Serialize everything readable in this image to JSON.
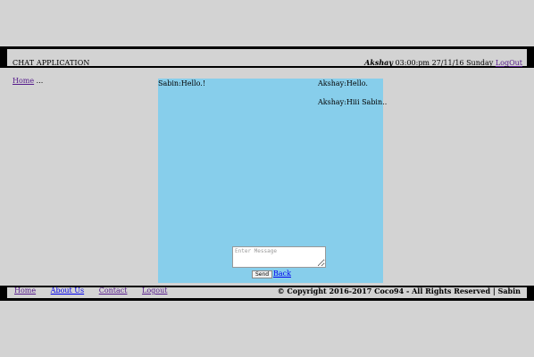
{
  "header": {
    "title": "CHAT APPLICATION",
    "user": "Akshay",
    "time": "03:00:pm",
    "date": "27/11/16",
    "day": "Sunday",
    "logout_label": "LogOut"
  },
  "breadcrumb": {
    "home_label": "Home",
    "suffix": "..."
  },
  "chat": {
    "messages": [
      {
        "text": "Sabin:Hello.!"
      },
      {
        "text": "Akshay:Hello."
      },
      {
        "text": "Akshay:Hiii Sabin.."
      }
    ],
    "input_placeholder": "Enter Message",
    "send_label": "Send",
    "back_label": "Back"
  },
  "footer": {
    "nav": [
      {
        "label": "Home"
      },
      {
        "label": "About Us"
      },
      {
        "label": "Contact"
      },
      {
        "label": "Logout"
      }
    ],
    "copyright": "© Copyright 2016-2017 Coco94 - All Rights Reserved | Sabin"
  }
}
